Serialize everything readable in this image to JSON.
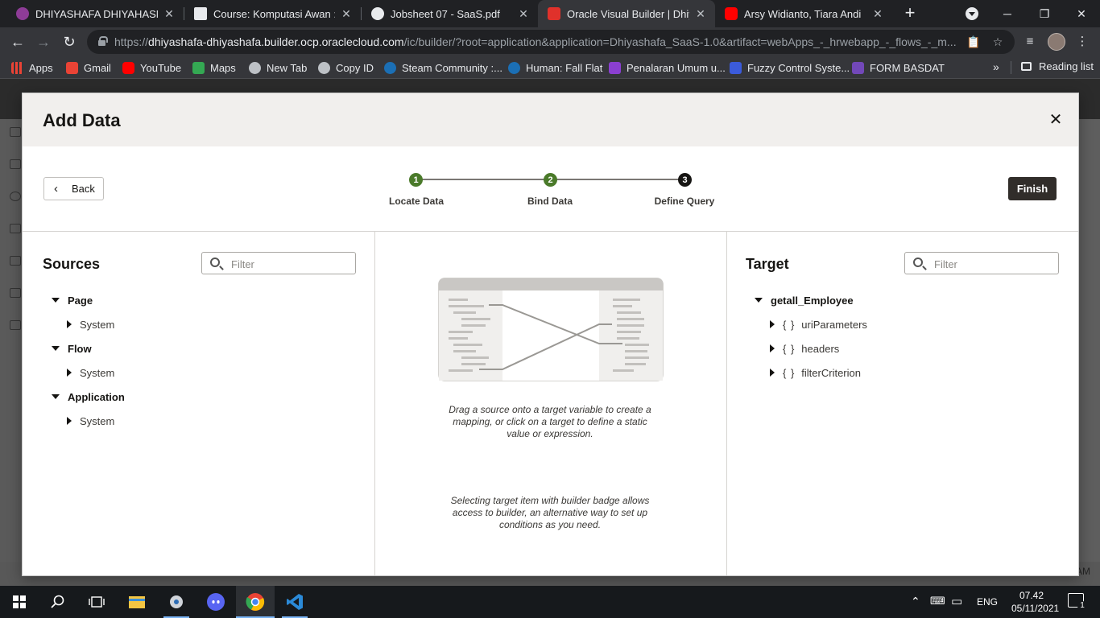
{
  "browser": {
    "tabs": [
      {
        "title": "DHIYASHAFA DHIYAHASNA H",
        "favicon_color": "#8e3c97"
      },
      {
        "title": "Course: Komputasi Awan : Di",
        "favicon_color": "#e8eaed"
      },
      {
        "title": "Jobsheet 07 - SaaS.pdf",
        "favicon_color": "#e8eaed"
      },
      {
        "title": "Oracle Visual Builder | Dhiyas",
        "favicon_color": "#e0312b",
        "active": true
      },
      {
        "title": "Arsy Widianto, Tiara Andi",
        "favicon_color": "#ff0000"
      }
    ],
    "tab_close_glyph": "✕",
    "new_tab_glyph": "+",
    "window_controls": {
      "minimize": "─",
      "restore": "❐",
      "close": "✕"
    },
    "url_prefix": "https://",
    "url_host": "dhiyashafa-dhiyashafa.builder.ocp.oraclecloud.com",
    "url_path": "/ic/builder/?root=application&application=Dhiyashafa_SaaS-1.0&artifact=webApps_-_hrwebapp_-_flows_-_m...",
    "bookmarks": [
      {
        "label": "Apps",
        "icon": "apps-grid-icon",
        "color": "#ea4335"
      },
      {
        "label": "Gmail",
        "icon": "gmail-icon",
        "color": "#ea4335"
      },
      {
        "label": "YouTube",
        "icon": "youtube-icon",
        "color": "#ff0000"
      },
      {
        "label": "Maps",
        "icon": "maps-icon",
        "color": "#34a853"
      },
      {
        "label": "New Tab",
        "icon": "globe-icon",
        "color": "#bdc1c6"
      },
      {
        "label": "Copy ID",
        "icon": "globe-icon",
        "color": "#bdc1c6"
      },
      {
        "label": "Steam Community :...",
        "icon": "steam-icon",
        "color": "#1b6fb5"
      },
      {
        "label": "Human: Fall Flat",
        "icon": "steam-icon",
        "color": "#1b6fb5"
      },
      {
        "label": "Penalaran Umum u...",
        "icon": "zenius-icon",
        "color": "#8b3fd1"
      },
      {
        "label": "Fuzzy Control Syste...",
        "icon": "scikit-icon",
        "color": "#3b5bdb"
      },
      {
        "label": "FORM BASDAT",
        "icon": "forms-icon",
        "color": "#7248b9"
      }
    ],
    "bookmarks_more": "»",
    "reading_list": "Reading list"
  },
  "app_bg": {
    "status_text": "AM"
  },
  "modal": {
    "title": "Add Data",
    "close_glyph": "✕",
    "back_label": "Back",
    "finish_label": "Finish",
    "steps": [
      {
        "number": "1",
        "label": "Locate Data",
        "state": "done"
      },
      {
        "number": "2",
        "label": "Bind Data",
        "state": "done"
      },
      {
        "number": "3",
        "label": "Define Query",
        "state": "current"
      }
    ],
    "colors": {
      "step_done": "#4a7a2a",
      "step_current": "#161513",
      "finish_bg": "#312d2a"
    },
    "sources": {
      "title": "Sources",
      "filter_placeholder": "Filter",
      "tree": [
        {
          "label": "Page",
          "children": [
            "System"
          ]
        },
        {
          "label": "Flow",
          "children": [
            "System"
          ]
        },
        {
          "label": "Application",
          "children": [
            "System"
          ]
        }
      ]
    },
    "center": {
      "hint1": "Drag a source onto a target variable to create a mapping, or click on a target to define a static value or expression.",
      "hint2": "Selecting target item with builder badge allows access to builder, an alternative way to set up conditions as you need."
    },
    "target": {
      "title": "Target",
      "filter_placeholder": "Filter",
      "root": "getall_Employee",
      "children": [
        {
          "label": "uriParameters",
          "icon": "{ }"
        },
        {
          "label": "headers",
          "icon": "{ }"
        },
        {
          "label": "filterCriterion",
          "icon": "{ }"
        }
      ]
    }
  },
  "taskbar": {
    "language": "ENG",
    "time": "07.42",
    "date": "05/11/2021",
    "notification_count": "1"
  }
}
